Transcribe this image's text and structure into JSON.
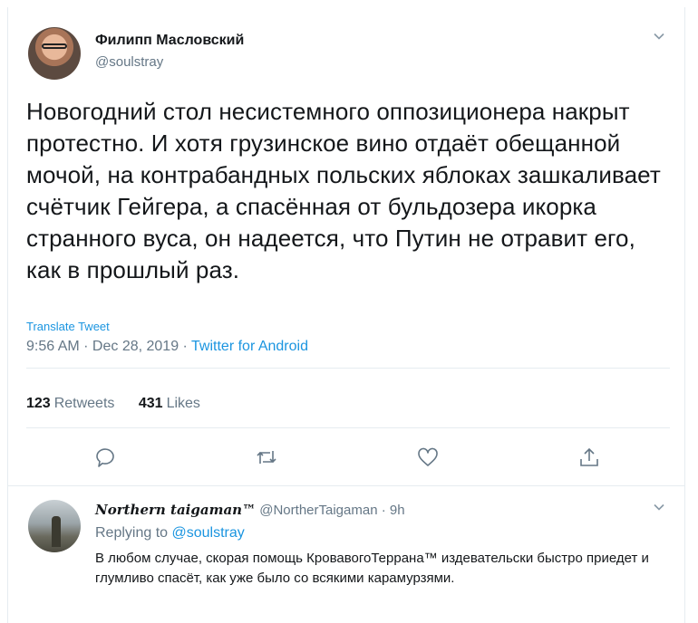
{
  "tweet": {
    "author_name": "Филипп Масловский",
    "handle": "@soulstray",
    "text": "Новогодний стол несистемного оппозиционера накрыт протестно. И хотя грузинское вино отдаёт обещанной мочой, на контрабандных польских яблоках зашкаливает счётчик Гейгера, а спасённая от бульдозера икорка странного вуса, он надеется, что Путин не отравит его, как в прошлый раз.",
    "translate_label": "Translate Tweet",
    "time": "9:56 AM · Dec 28, 2019 · ",
    "source": "Twitter for Android",
    "retweets_count": "123",
    "retweets_label": "Retweets",
    "likes_count": "431",
    "likes_label": "Likes"
  },
  "actions": {
    "reply_icon": "reply-icon",
    "retweet_icon": "retweet-icon",
    "like_icon": "heart-icon",
    "share_icon": "share-icon"
  },
  "reply": {
    "author_name": "Northern taigaman™",
    "handle": "@NortherTaigaman",
    "time": "· 9h",
    "replying_prefix": "Replying to",
    "replying_to": "@soulstray",
    "text": "В любом случае, скорая помощь КровавогоТеррана™ издевательски быстро приедет и глумливо спасёт, как уже было со всякими карамурзями."
  },
  "colors": {
    "accent": "#1b95e0",
    "secondary_text": "#657786",
    "border": "#e6ecf0"
  }
}
